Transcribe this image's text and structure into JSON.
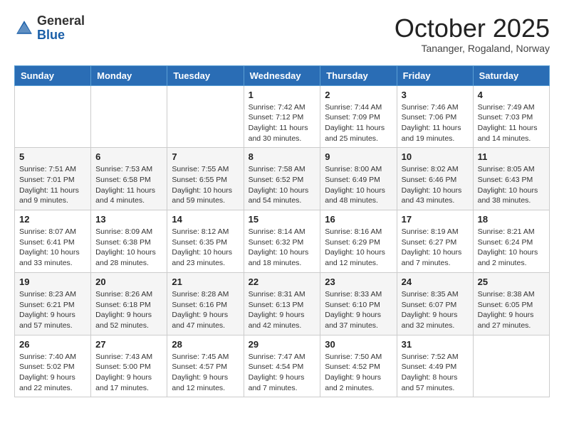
{
  "header": {
    "logo_general": "General",
    "logo_blue": "Blue",
    "month": "October 2025",
    "location": "Tananger, Rogaland, Norway"
  },
  "days_of_week": [
    "Sunday",
    "Monday",
    "Tuesday",
    "Wednesday",
    "Thursday",
    "Friday",
    "Saturday"
  ],
  "weeks": [
    [
      {
        "day": "",
        "info": ""
      },
      {
        "day": "",
        "info": ""
      },
      {
        "day": "",
        "info": ""
      },
      {
        "day": "1",
        "info": "Sunrise: 7:42 AM\nSunset: 7:12 PM\nDaylight: 11 hours\nand 30 minutes."
      },
      {
        "day": "2",
        "info": "Sunrise: 7:44 AM\nSunset: 7:09 PM\nDaylight: 11 hours\nand 25 minutes."
      },
      {
        "day": "3",
        "info": "Sunrise: 7:46 AM\nSunset: 7:06 PM\nDaylight: 11 hours\nand 19 minutes."
      },
      {
        "day": "4",
        "info": "Sunrise: 7:49 AM\nSunset: 7:03 PM\nDaylight: 11 hours\nand 14 minutes."
      }
    ],
    [
      {
        "day": "5",
        "info": "Sunrise: 7:51 AM\nSunset: 7:01 PM\nDaylight: 11 hours\nand 9 minutes."
      },
      {
        "day": "6",
        "info": "Sunrise: 7:53 AM\nSunset: 6:58 PM\nDaylight: 11 hours\nand 4 minutes."
      },
      {
        "day": "7",
        "info": "Sunrise: 7:55 AM\nSunset: 6:55 PM\nDaylight: 10 hours\nand 59 minutes."
      },
      {
        "day": "8",
        "info": "Sunrise: 7:58 AM\nSunset: 6:52 PM\nDaylight: 10 hours\nand 54 minutes."
      },
      {
        "day": "9",
        "info": "Sunrise: 8:00 AM\nSunset: 6:49 PM\nDaylight: 10 hours\nand 48 minutes."
      },
      {
        "day": "10",
        "info": "Sunrise: 8:02 AM\nSunset: 6:46 PM\nDaylight: 10 hours\nand 43 minutes."
      },
      {
        "day": "11",
        "info": "Sunrise: 8:05 AM\nSunset: 6:43 PM\nDaylight: 10 hours\nand 38 minutes."
      }
    ],
    [
      {
        "day": "12",
        "info": "Sunrise: 8:07 AM\nSunset: 6:41 PM\nDaylight: 10 hours\nand 33 minutes."
      },
      {
        "day": "13",
        "info": "Sunrise: 8:09 AM\nSunset: 6:38 PM\nDaylight: 10 hours\nand 28 minutes."
      },
      {
        "day": "14",
        "info": "Sunrise: 8:12 AM\nSunset: 6:35 PM\nDaylight: 10 hours\nand 23 minutes."
      },
      {
        "day": "15",
        "info": "Sunrise: 8:14 AM\nSunset: 6:32 PM\nDaylight: 10 hours\nand 18 minutes."
      },
      {
        "day": "16",
        "info": "Sunrise: 8:16 AM\nSunset: 6:29 PM\nDaylight: 10 hours\nand 12 minutes."
      },
      {
        "day": "17",
        "info": "Sunrise: 8:19 AM\nSunset: 6:27 PM\nDaylight: 10 hours\nand 7 minutes."
      },
      {
        "day": "18",
        "info": "Sunrise: 8:21 AM\nSunset: 6:24 PM\nDaylight: 10 hours\nand 2 minutes."
      }
    ],
    [
      {
        "day": "19",
        "info": "Sunrise: 8:23 AM\nSunset: 6:21 PM\nDaylight: 9 hours\nand 57 minutes."
      },
      {
        "day": "20",
        "info": "Sunrise: 8:26 AM\nSunset: 6:18 PM\nDaylight: 9 hours\nand 52 minutes."
      },
      {
        "day": "21",
        "info": "Sunrise: 8:28 AM\nSunset: 6:16 PM\nDaylight: 9 hours\nand 47 minutes."
      },
      {
        "day": "22",
        "info": "Sunrise: 8:31 AM\nSunset: 6:13 PM\nDaylight: 9 hours\nand 42 minutes."
      },
      {
        "day": "23",
        "info": "Sunrise: 8:33 AM\nSunset: 6:10 PM\nDaylight: 9 hours\nand 37 minutes."
      },
      {
        "day": "24",
        "info": "Sunrise: 8:35 AM\nSunset: 6:07 PM\nDaylight: 9 hours\nand 32 minutes."
      },
      {
        "day": "25",
        "info": "Sunrise: 8:38 AM\nSunset: 6:05 PM\nDaylight: 9 hours\nand 27 minutes."
      }
    ],
    [
      {
        "day": "26",
        "info": "Sunrise: 7:40 AM\nSunset: 5:02 PM\nDaylight: 9 hours\nand 22 minutes."
      },
      {
        "day": "27",
        "info": "Sunrise: 7:43 AM\nSunset: 5:00 PM\nDaylight: 9 hours\nand 17 minutes."
      },
      {
        "day": "28",
        "info": "Sunrise: 7:45 AM\nSunset: 4:57 PM\nDaylight: 9 hours\nand 12 minutes."
      },
      {
        "day": "29",
        "info": "Sunrise: 7:47 AM\nSunset: 4:54 PM\nDaylight: 9 hours\nand 7 minutes."
      },
      {
        "day": "30",
        "info": "Sunrise: 7:50 AM\nSunset: 4:52 PM\nDaylight: 9 hours\nand 2 minutes."
      },
      {
        "day": "31",
        "info": "Sunrise: 7:52 AM\nSunset: 4:49 PM\nDaylight: 8 hours\nand 57 minutes."
      },
      {
        "day": "",
        "info": ""
      }
    ]
  ]
}
